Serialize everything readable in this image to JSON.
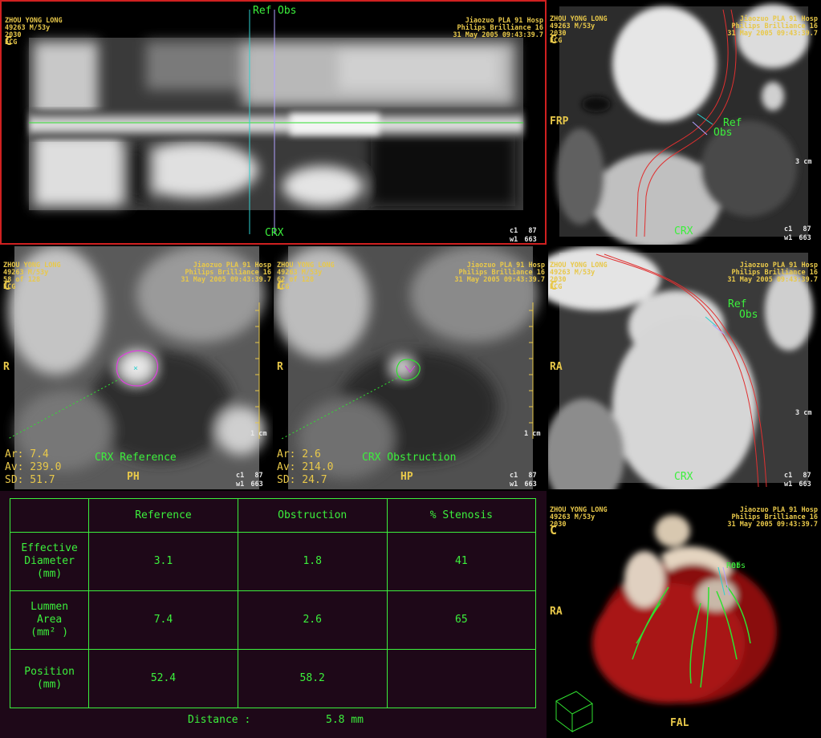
{
  "patient": {
    "name": "ZHOU YONG LONG",
    "id_age": "49263 M/53y",
    "num": "2030",
    "ecg": "ECG"
  },
  "site": {
    "hospital": "Jiaozuo PLA 91 Hosp",
    "scanner": "Philips Brilliance 16",
    "datetime": "31 May 2005 09:43:39.7"
  },
  "orientation": {
    "c": "C",
    "r": "R",
    "ra": "RA",
    "frp": "FRP",
    "fal": "FAL",
    "crx": "CRX"
  },
  "window": {
    "c1": "c1",
    "c1_val": "87",
    "w1": "w1",
    "w1_val": "663"
  },
  "markers": {
    "ref": "Ref",
    "obs": "Obs"
  },
  "scale": {
    "one_cm": "1 cm",
    "three_cm": "3 cm"
  },
  "cross_ref": {
    "slice": "58 of 128",
    "ar": "Ar: 7.4",
    "av": "Av: 239.0",
    "sd": "SD: 51.7",
    "caption": "CRX Reference",
    "mode": "PH"
  },
  "cross_obs": {
    "slice": "62 of 128",
    "ar": "Ar: 2.6",
    "av": "Av: 214.0",
    "sd": "SD: 24.7",
    "caption": "CRX Obstruction",
    "mode": "HP"
  },
  "results": {
    "headers": [
      "",
      "Reference",
      "Obstruction",
      "% Stenosis"
    ],
    "rows": [
      {
        "label1": "Effective",
        "label2": "Diameter",
        "label3": "(mm)",
        "ref": "3.1",
        "obs": "1.8",
        "stenosis": "41"
      },
      {
        "label1": "Lummen",
        "label2": "Area",
        "label3": "(mm² )",
        "ref": "7.4",
        "obs": "2.6",
        "stenosis": "65"
      },
      {
        "label1": "Position",
        "label2": "(mm)",
        "label3": "",
        "ref": "52.4",
        "obs": "58.2",
        "stenosis": ""
      }
    ],
    "distance_label": "Distance :",
    "distance_value": "5.8 mm"
  },
  "colors": {
    "accent_yellow": "#e8c84a",
    "table_green": "#3cf03c",
    "active_border": "#d02020",
    "table_bg": "#1e0818"
  }
}
